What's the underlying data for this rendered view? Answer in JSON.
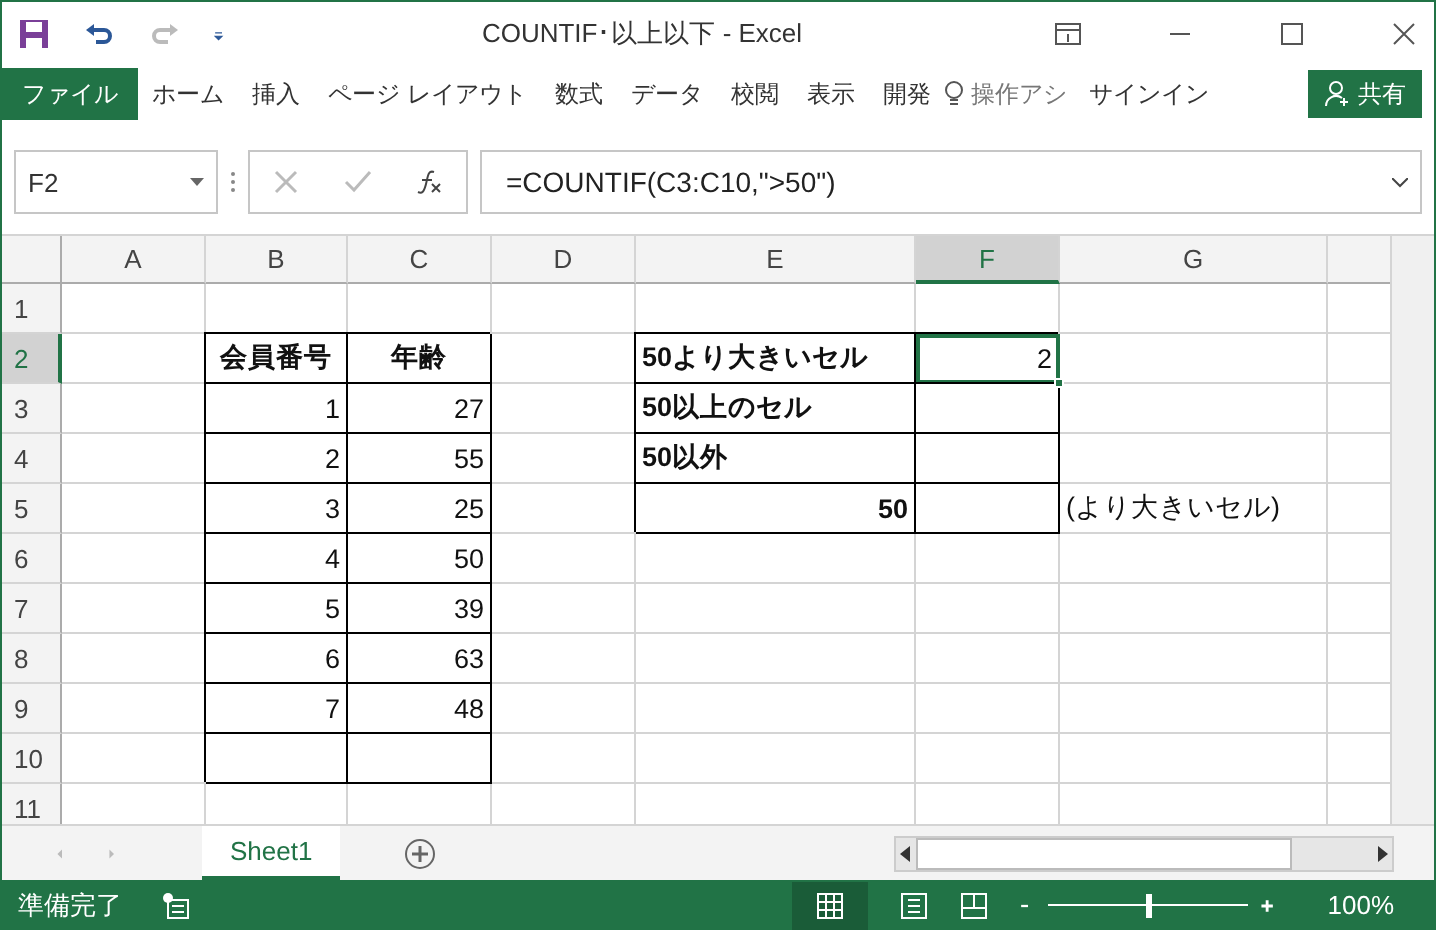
{
  "window": {
    "title": "COUNTIF･以上以下 - Excel"
  },
  "ribbon": {
    "file_tab": "ファイル",
    "tabs": [
      "ホーム",
      "挿入",
      "ページ レイアウト",
      "数式",
      "データ",
      "校閲",
      "表示",
      "開発"
    ],
    "tell_me": "操作アシ",
    "sign_in": "サインイン",
    "share": "共有"
  },
  "formula_bar": {
    "name_box": "F2",
    "formula": "=COUNTIF(C3:C10,\">50\")"
  },
  "sheet": {
    "columns": [
      {
        "label": "A",
        "selected": false
      },
      {
        "label": "B",
        "selected": false
      },
      {
        "label": "C",
        "selected": false
      },
      {
        "label": "D",
        "selected": false
      },
      {
        "label": "E",
        "selected": false
      },
      {
        "label": "F",
        "selected": true
      },
      {
        "label": "G",
        "selected": false
      }
    ],
    "rows": [
      {
        "number": "1",
        "selected": false,
        "cells": [
          {
            "text": ""
          },
          {
            "text": ""
          },
          {
            "text": ""
          },
          {
            "text": ""
          },
          {
            "text": ""
          },
          {
            "text": ""
          },
          {
            "text": ""
          }
        ]
      },
      {
        "number": "2",
        "selected": true,
        "cells": [
          {
            "text": ""
          },
          {
            "text": "会員番号",
            "bold": true,
            "centered": true,
            "boxed": true
          },
          {
            "text": "年齢",
            "bold": true,
            "centered": true,
            "boxed": true
          },
          {
            "text": ""
          },
          {
            "text": "50より大きいセル",
            "bold": true,
            "boxed": true
          },
          {
            "text": "2",
            "boxed": true,
            "active": true
          },
          {
            "text": ""
          }
        ]
      },
      {
        "number": "3",
        "selected": false,
        "cells": [
          {
            "text": ""
          },
          {
            "text": "1",
            "boxed": true
          },
          {
            "text": "27",
            "boxed": true
          },
          {
            "text": ""
          },
          {
            "text": "50以上のセル",
            "bold": true,
            "boxed": true
          },
          {
            "text": "",
            "boxed": true
          },
          {
            "text": ""
          }
        ]
      },
      {
        "number": "4",
        "selected": false,
        "cells": [
          {
            "text": ""
          },
          {
            "text": "2",
            "boxed": true
          },
          {
            "text": "55",
            "boxed": true
          },
          {
            "text": ""
          },
          {
            "text": "50以外",
            "bold": true,
            "boxed": true
          },
          {
            "text": "",
            "boxed": true
          },
          {
            "text": ""
          }
        ]
      },
      {
        "number": "5",
        "selected": false,
        "cells": [
          {
            "text": ""
          },
          {
            "text": "3",
            "boxed": true
          },
          {
            "text": "25",
            "boxed": true
          },
          {
            "text": ""
          },
          {
            "text": "50",
            "bold": true,
            "boxed": true
          },
          {
            "text": "",
            "boxed": true
          },
          {
            "text": "(より大きいセル)"
          }
        ]
      },
      {
        "number": "6",
        "selected": false,
        "cells": [
          {
            "text": ""
          },
          {
            "text": "4",
            "boxed": true
          },
          {
            "text": "50",
            "boxed": true
          },
          {
            "text": ""
          },
          {
            "text": ""
          },
          {
            "text": ""
          },
          {
            "text": ""
          }
        ]
      },
      {
        "number": "7",
        "selected": false,
        "cells": [
          {
            "text": ""
          },
          {
            "text": "5",
            "boxed": true
          },
          {
            "text": "39",
            "boxed": true
          },
          {
            "text": ""
          },
          {
            "text": ""
          },
          {
            "text": ""
          },
          {
            "text": ""
          }
        ]
      },
      {
        "number": "8",
        "selected": false,
        "cells": [
          {
            "text": ""
          },
          {
            "text": "6",
            "boxed": true
          },
          {
            "text": "63",
            "boxed": true
          },
          {
            "text": ""
          },
          {
            "text": ""
          },
          {
            "text": ""
          },
          {
            "text": ""
          }
        ]
      },
      {
        "number": "9",
        "selected": false,
        "cells": [
          {
            "text": ""
          },
          {
            "text": "7",
            "boxed": true
          },
          {
            "text": "48",
            "boxed": true
          },
          {
            "text": ""
          },
          {
            "text": ""
          },
          {
            "text": ""
          },
          {
            "text": ""
          }
        ]
      },
      {
        "number": "10",
        "selected": false,
        "cells": [
          {
            "text": ""
          },
          {
            "text": "",
            "boxed": true
          },
          {
            "text": "",
            "boxed": true
          },
          {
            "text": ""
          },
          {
            "text": ""
          },
          {
            "text": ""
          },
          {
            "text": ""
          }
        ]
      },
      {
        "number": "11",
        "selected": false,
        "cells": [
          {
            "text": ""
          },
          {
            "text": ""
          },
          {
            "text": ""
          },
          {
            "text": ""
          },
          {
            "text": ""
          },
          {
            "text": ""
          },
          {
            "text": ""
          }
        ]
      }
    ]
  },
  "sheet_tabs": [
    {
      "label": "Sheet1",
      "selected": true
    }
  ],
  "status_bar": {
    "status": "準備完了",
    "zoom": {
      "level": 0.5,
      "reading": "100%"
    }
  }
}
